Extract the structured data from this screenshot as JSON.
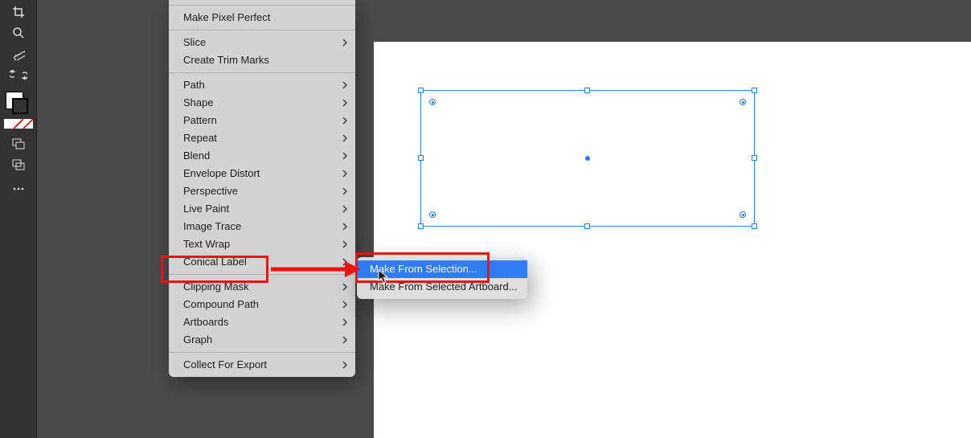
{
  "menu": {
    "section1": [
      {
        "label": "Make Pixel Perfect",
        "sub": false
      }
    ],
    "section2": [
      {
        "label": "Slice",
        "sub": true
      },
      {
        "label": "Create Trim Marks",
        "sub": false
      }
    ],
    "section3": [
      {
        "label": "Path",
        "sub": true
      },
      {
        "label": "Shape",
        "sub": true
      },
      {
        "label": "Pattern",
        "sub": true
      },
      {
        "label": "Repeat",
        "sub": true
      },
      {
        "label": "Blend",
        "sub": true
      },
      {
        "label": "Envelope Distort",
        "sub": true
      },
      {
        "label": "Perspective",
        "sub": true
      },
      {
        "label": "Live Paint",
        "sub": true
      },
      {
        "label": "Image Trace",
        "sub": true
      },
      {
        "label": "Text Wrap",
        "sub": true
      },
      {
        "label": "Conical Label",
        "sub": true,
        "highlight": true
      }
    ],
    "section4": [
      {
        "label": "Clipping Mask",
        "sub": true
      },
      {
        "label": "Compound Path",
        "sub": true
      },
      {
        "label": "Artboards",
        "sub": true
      },
      {
        "label": "Graph",
        "sub": true
      }
    ],
    "section5": [
      {
        "label": "Collect For Export",
        "sub": true
      }
    ]
  },
  "submenu": {
    "items": [
      {
        "label": "Make From Selection...",
        "highlighted": true
      },
      {
        "label": "Make From Selected Artboard..."
      }
    ]
  }
}
